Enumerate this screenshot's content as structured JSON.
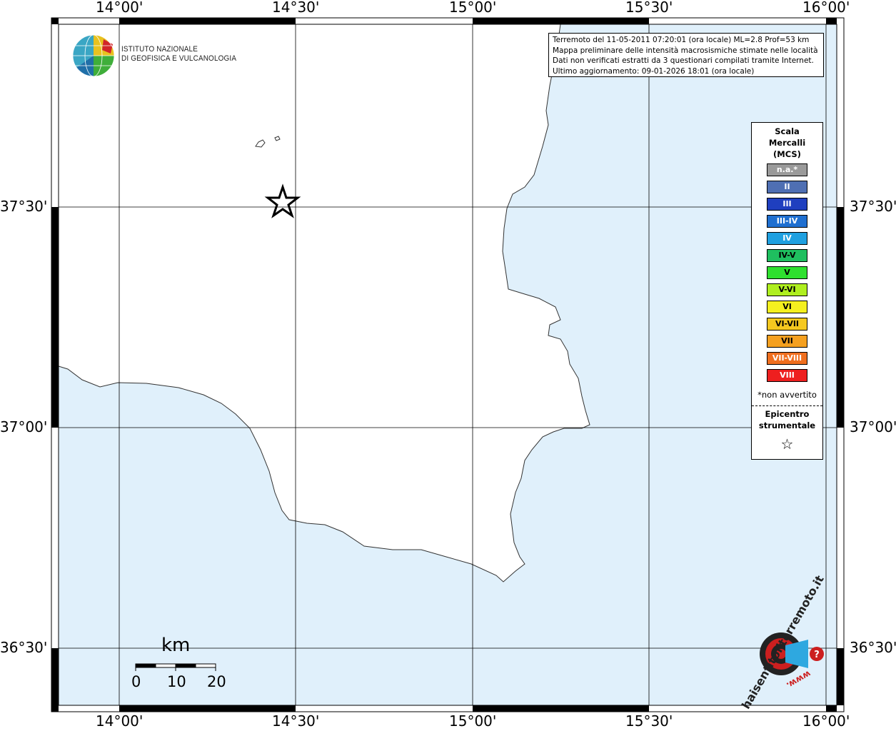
{
  "map": {
    "title": "Terremoto del 11-05-2011 07:20:01 (ora locale) ML=2.8 Prof=53 km",
    "info_lines": [
      "Terremoto del 11-05-2011 07:20:01 (ora locale) ML=2.8 Prof=53 km",
      "Mappa preliminare delle intensità macrosismiche stimate nelle località",
      "Dati non verificati estratti da 3 questionari compilati tramite Internet.",
      "Ultimo aggiornamento: 09-01-2026 18:01 (ora locale)"
    ],
    "lon_labels": [
      "14°00'",
      "14°30'",
      "15°00'",
      "15°30'",
      "16°00'"
    ],
    "lat_labels": [
      "37°30'",
      "37°00'",
      "36°30'"
    ],
    "colors": {
      "sea": "#e0f0fb",
      "land": "#ffffff",
      "coast": "#333333",
      "grid": "#000000"
    }
  },
  "institute": {
    "line1": "ISTITUTO NAZIONALE",
    "line2": "DI GEOFISICA E VULCANOLOGIA"
  },
  "legend": {
    "title_line1": "Scala",
    "title_line2": "Mercalli",
    "title_line3": "(MCS)",
    "items": [
      {
        "label": "n.a.*",
        "color": "#9a9a9a"
      },
      {
        "label": "II",
        "color": "#4f6fb3"
      },
      {
        "label": "III",
        "color": "#1f3fbf"
      },
      {
        "label": "III-IV",
        "color": "#1f6fd0"
      },
      {
        "label": "IV",
        "color": "#1fa0e0"
      },
      {
        "label": "IV-V",
        "color": "#1fbf5f"
      },
      {
        "label": "V",
        "color": "#2fe02f"
      },
      {
        "label": "V-VI",
        "color": "#afef1f"
      },
      {
        "label": "VI",
        "color": "#f5f01f"
      },
      {
        "label": "VI-VII",
        "color": "#f5c81f"
      },
      {
        "label": "VII",
        "color": "#f5a01f"
      },
      {
        "label": "VII-VIII",
        "color": "#f06f1f"
      },
      {
        "label": "VIII",
        "color": "#ee1f1f"
      }
    ],
    "footnote": "*non avvertito",
    "epicenter_line1": "Epicentro",
    "epicenter_line2": "strumentale",
    "epicenter_symbol": "☆"
  },
  "scale_bar": {
    "title": "km",
    "labels": [
      "0",
      "10",
      "20"
    ]
  },
  "epicenter": {
    "icon": "star-icon"
  },
  "brand": {
    "text": "haisentitoilterremoto.it",
    "prefix": "www."
  }
}
